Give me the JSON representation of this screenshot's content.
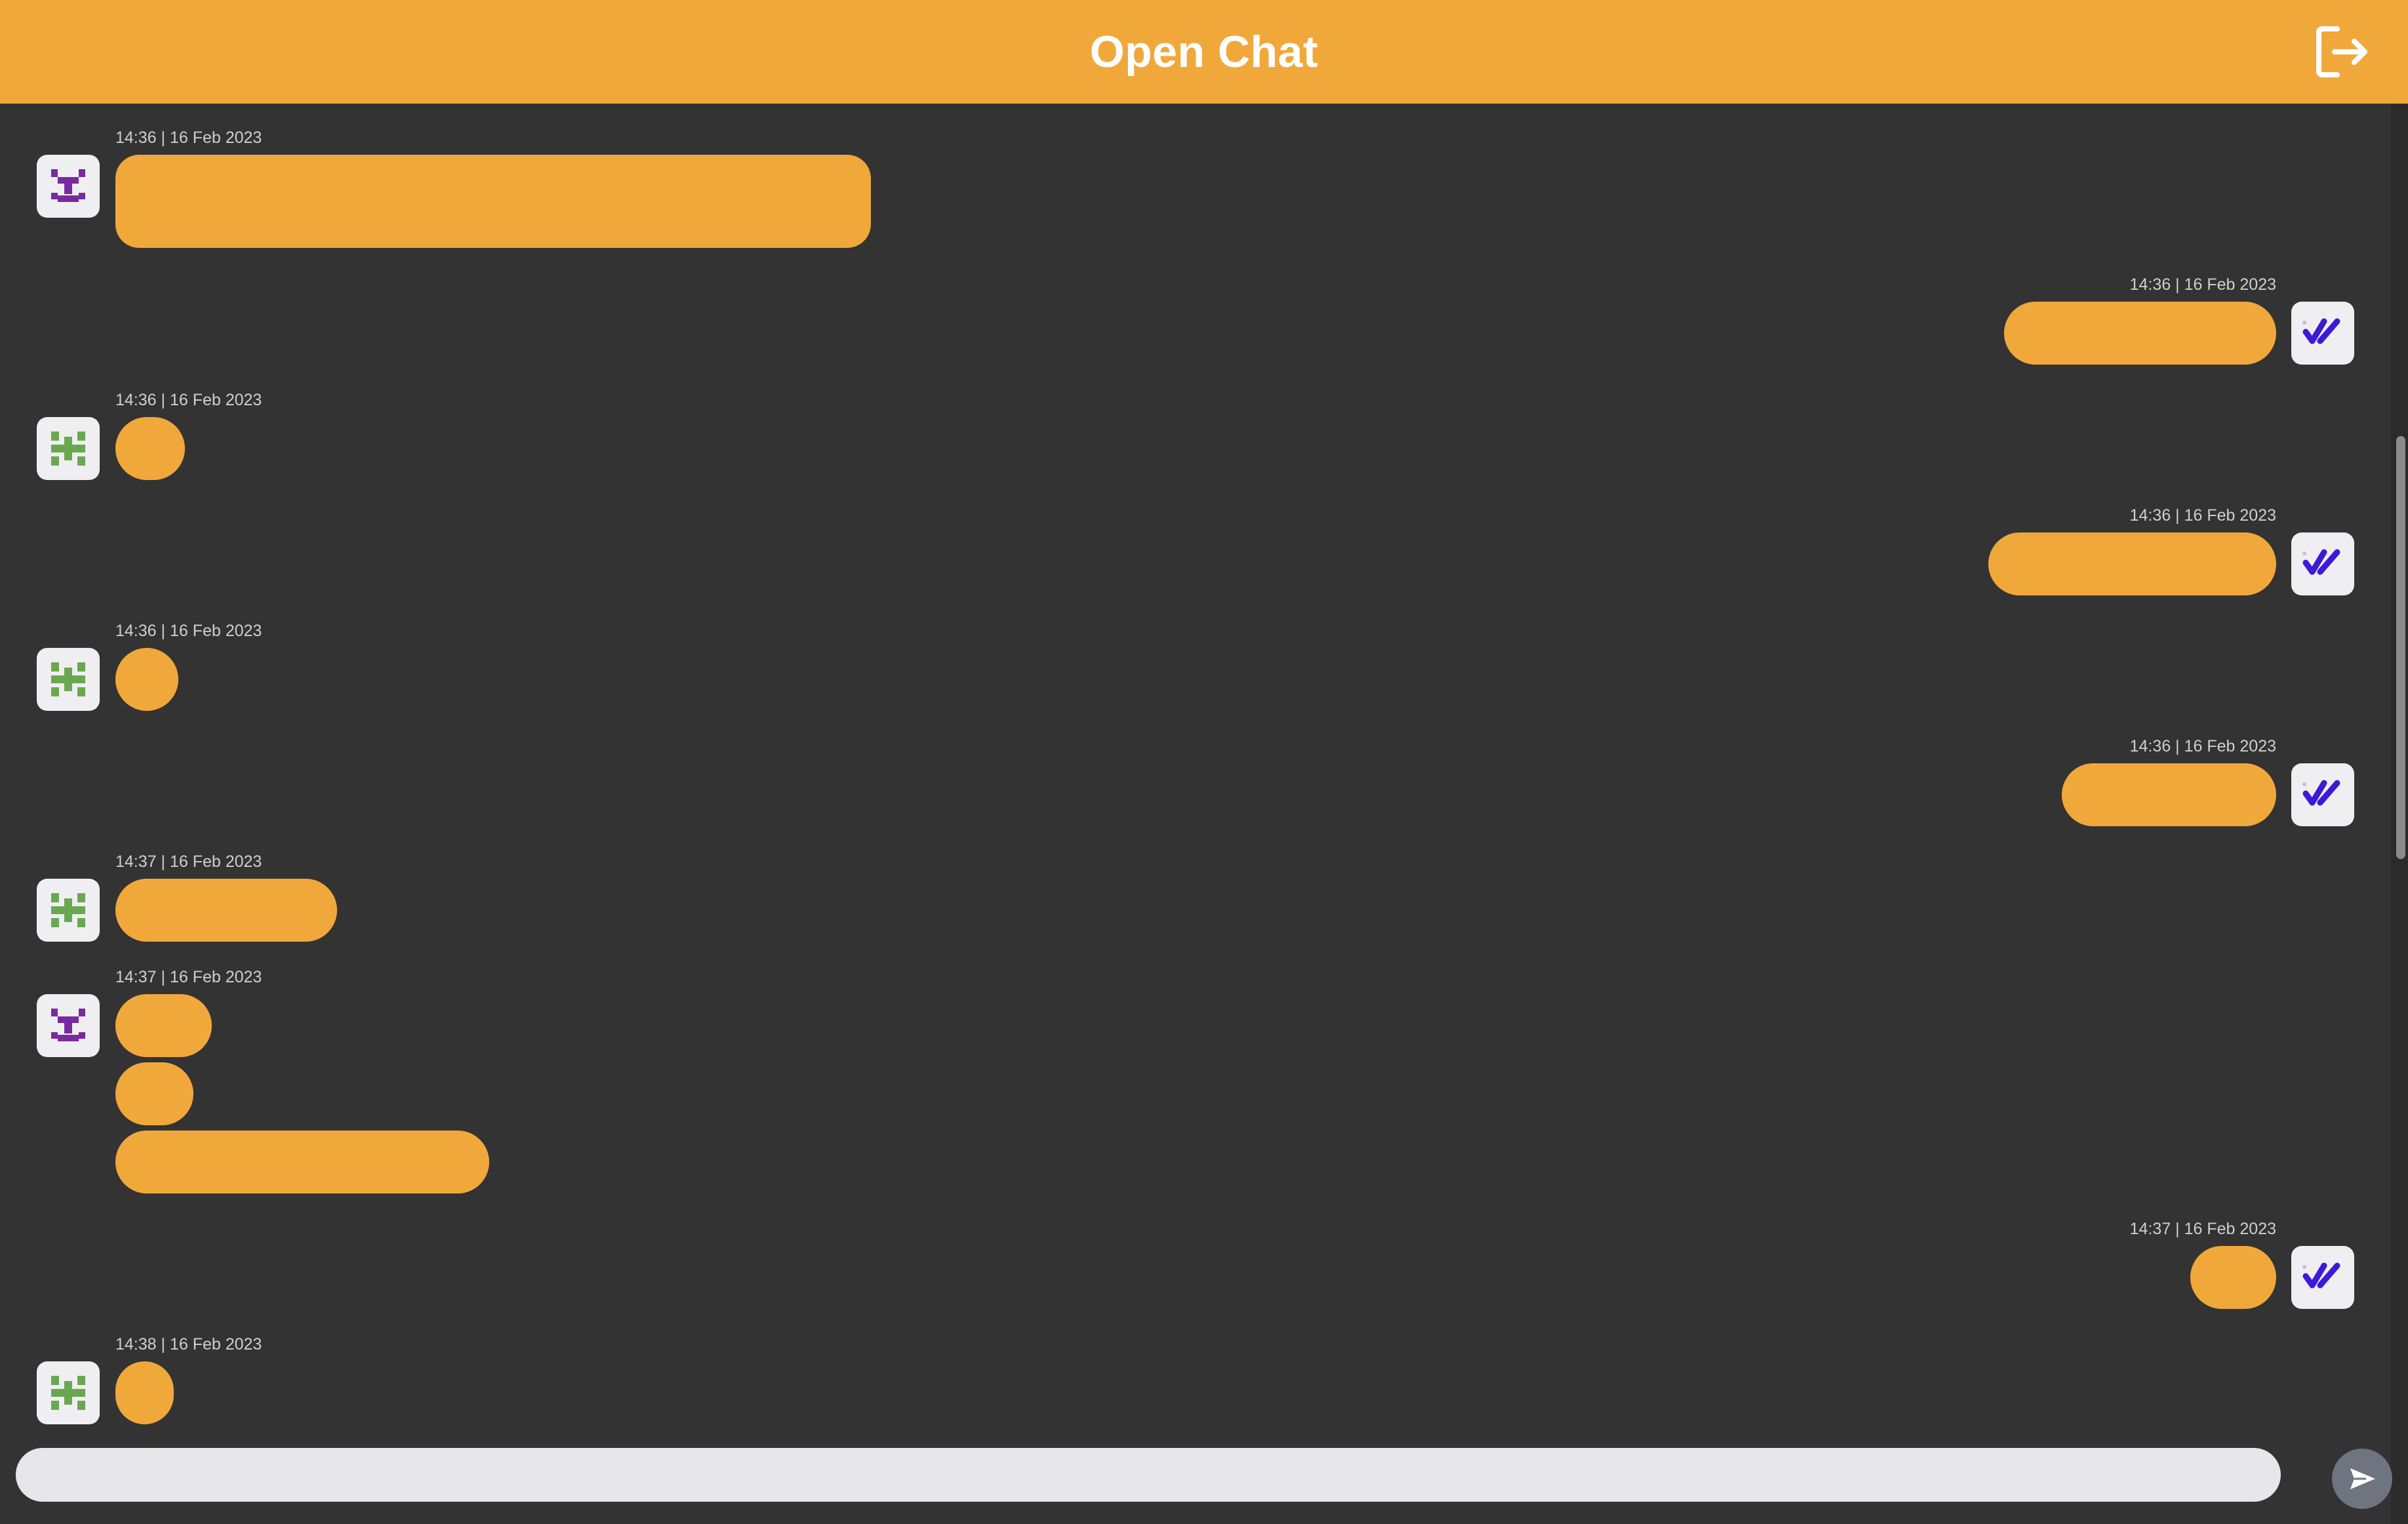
{
  "header": {
    "title": "Open Chat",
    "logout_icon": "logout-icon"
  },
  "messages": [
    {
      "side": "left",
      "avatar": "purple-pixel-avatar",
      "timestamp": "14:36 | 16 Feb 2023"
    },
    {
      "side": "right",
      "avatar": "double-check-avatar",
      "timestamp": "14:36 | 16 Feb 2023"
    },
    {
      "side": "left",
      "avatar": "green-pixel-avatar",
      "timestamp": "14:36 | 16 Feb 2023"
    },
    {
      "side": "right",
      "avatar": "double-check-avatar",
      "timestamp": "14:36 | 16 Feb 2023"
    },
    {
      "side": "left",
      "avatar": "green-pixel-avatar",
      "timestamp": "14:36 | 16 Feb 2023"
    },
    {
      "side": "right",
      "avatar": "double-check-avatar",
      "timestamp": "14:36 | 16 Feb 2023"
    },
    {
      "side": "left",
      "avatar": "green-pixel-avatar",
      "timestamp": "14:37 | 16 Feb 2023"
    },
    {
      "side": "left",
      "avatar": "purple-pixel-avatar",
      "timestamp": "14:37 | 16 Feb 2023"
    },
    {
      "side": "right",
      "avatar": "double-check-avatar",
      "timestamp": "14:37 | 16 Feb 2023"
    },
    {
      "side": "left",
      "avatar": "green-pixel-avatar",
      "timestamp": "14:38 | 16 Feb 2023"
    }
  ],
  "composer": {
    "placeholder": "",
    "send_icon": "send-icon"
  },
  "colors": {
    "accent": "#f1a83b",
    "background": "#333333",
    "input": "#e7e7ea",
    "send_button": "#6e7480",
    "purple_avatar": "#7a2aa0",
    "green_avatar": "#6aa84f",
    "check_icon": "#3d1ad6"
  }
}
